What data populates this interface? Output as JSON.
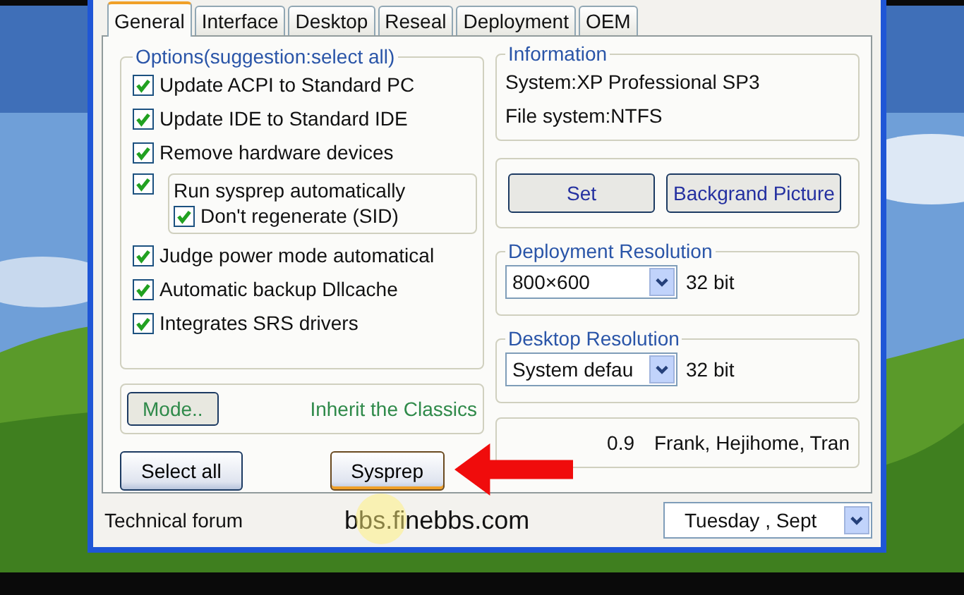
{
  "tabs": [
    {
      "label": "General",
      "selected": true
    },
    {
      "label": "Interface",
      "selected": false
    },
    {
      "label": "Desktop",
      "selected": false
    },
    {
      "label": "Reseal",
      "selected": false
    },
    {
      "label": "Deployment",
      "selected": false
    },
    {
      "label": "OEM",
      "selected": false
    }
  ],
  "options": {
    "title": "Options(suggestion:select all)",
    "items": [
      {
        "kind": "check",
        "label": "Update ACPI to Standard PC",
        "checked": true
      },
      {
        "kind": "check",
        "label": "Update IDE to Standard IDE",
        "checked": true
      },
      {
        "kind": "check",
        "label": "Remove hardware devices",
        "checked": true
      },
      {
        "kind": "group",
        "label": "Run sysprep automatically",
        "checked": true,
        "children": [
          {
            "label": "Don't regenerate (SID)",
            "checked": true
          }
        ]
      },
      {
        "kind": "check",
        "label": "Judge power mode automatical",
        "checked": true
      },
      {
        "kind": "check",
        "label": "Automatic backup Dllcache",
        "checked": true
      },
      {
        "kind": "check",
        "label": "Integrates SRS drivers",
        "checked": true
      }
    ]
  },
  "mode": {
    "button": "Mode..",
    "label": "Inherit the Classics"
  },
  "buttons": {
    "select_all": "Select all",
    "sysprep": "Sysprep"
  },
  "information": {
    "title": "Information",
    "lines": [
      "System:XP Professional SP3",
      "File system:NTFS"
    ]
  },
  "actions": [
    "Set",
    "Backgrand Picture"
  ],
  "resolutions": [
    {
      "title": "Deployment Resolution",
      "value": "800×600",
      "unit": "32 bit"
    },
    {
      "title": "Desktop Resolution",
      "value": "System defau",
      "unit": "32 bit"
    }
  ],
  "about": {
    "version": "0.9",
    "authors": "Frank, Hejihome, Tran"
  },
  "status_bar": {
    "label": "Technical forum",
    "link": "bbs.finebbs.com",
    "date": "Tuesday  , Sept"
  }
}
